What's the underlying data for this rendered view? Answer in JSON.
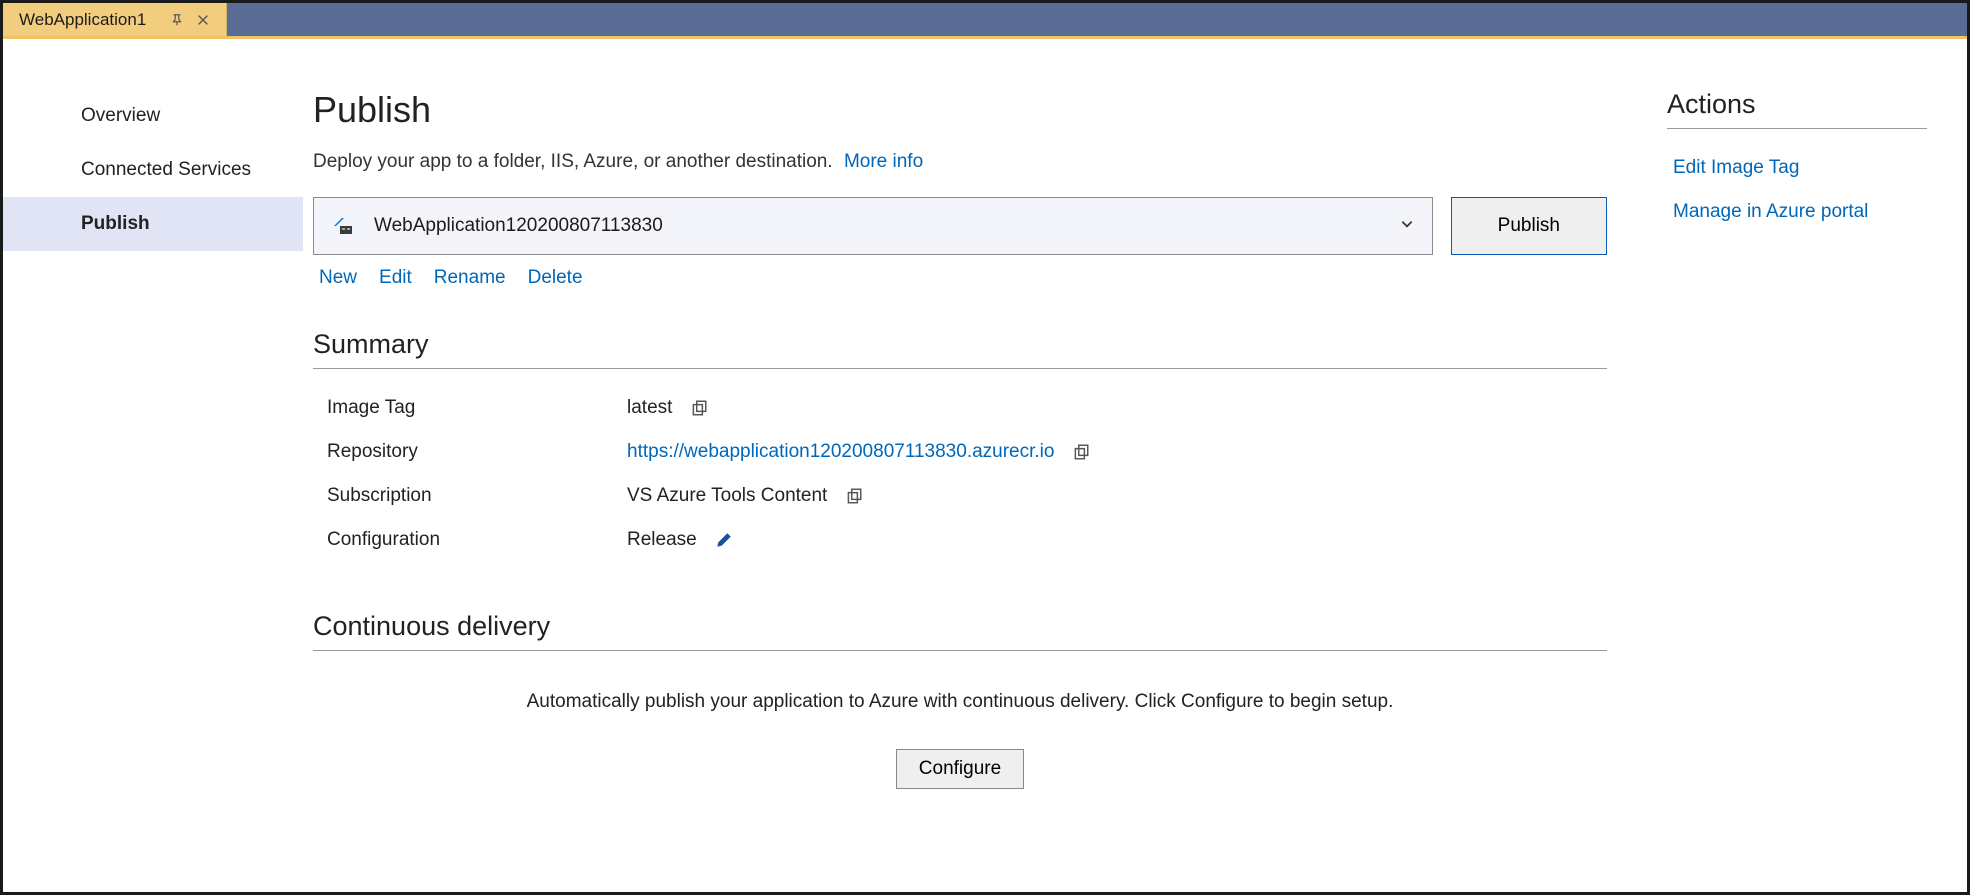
{
  "tab": {
    "title": "WebApplication1"
  },
  "sidebar": {
    "items": [
      {
        "label": "Overview"
      },
      {
        "label": "Connected Services"
      },
      {
        "label": "Publish"
      }
    ]
  },
  "page": {
    "title": "Publish",
    "subtitle": "Deploy your app to a folder, IIS, Azure, or another destination.",
    "more_info": "More info"
  },
  "profile": {
    "selected": "WebApplication120200807113830",
    "publish_button": "Publish",
    "links": {
      "new": "New",
      "edit": "Edit",
      "rename": "Rename",
      "delete": "Delete"
    }
  },
  "summary": {
    "heading": "Summary",
    "rows": {
      "image_tag": {
        "label": "Image Tag",
        "value": "latest"
      },
      "repository": {
        "label": "Repository",
        "value": "https://webapplication120200807113830.azurecr.io"
      },
      "subscription": {
        "label": "Subscription",
        "value": "VS Azure Tools Content"
      },
      "configuration": {
        "label": "Configuration",
        "value": "Release"
      }
    }
  },
  "actions": {
    "heading": "Actions",
    "items": [
      {
        "label": "Edit Image Tag"
      },
      {
        "label": "Manage in Azure portal"
      }
    ]
  },
  "cd": {
    "heading": "Continuous delivery",
    "text": "Automatically publish your application to Azure with continuous delivery. Click Configure to begin setup.",
    "button": "Configure"
  }
}
